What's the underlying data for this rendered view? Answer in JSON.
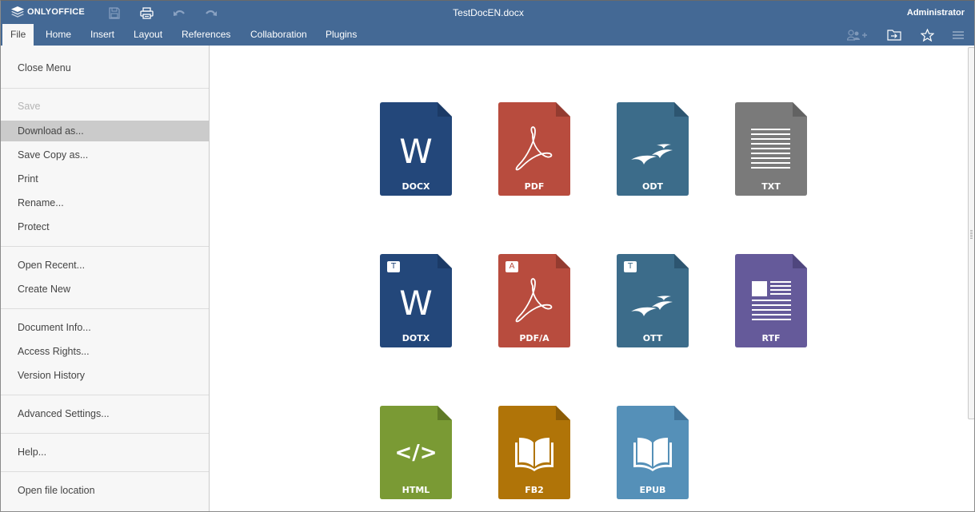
{
  "app": {
    "brand": "ONLYOFFICE",
    "document_title": "TestDocEN.docx",
    "user": "Administrator"
  },
  "quick_access": [
    {
      "name": "save-icon",
      "enabled": false
    },
    {
      "name": "print-icon",
      "enabled": true
    },
    {
      "name": "undo-icon",
      "enabled": false
    },
    {
      "name": "redo-icon",
      "enabled": false
    }
  ],
  "tabs": [
    {
      "label": "File",
      "active": true
    },
    {
      "label": "Home"
    },
    {
      "label": "Insert"
    },
    {
      "label": "Layout"
    },
    {
      "label": "References"
    },
    {
      "label": "Collaboration"
    },
    {
      "label": "Plugins"
    }
  ],
  "right_toolbar": [
    {
      "name": "add-user-icon",
      "enabled": false
    },
    {
      "name": "open-location-icon",
      "enabled": true
    },
    {
      "name": "favorite-star-icon",
      "enabled": true
    },
    {
      "name": "hamburger-menu-icon",
      "enabled": true
    }
  ],
  "file_menu": {
    "items": [
      {
        "label": "Close Menu"
      },
      {
        "label": "Save",
        "disabled": true
      },
      {
        "label": "Download as...",
        "selected": true
      },
      {
        "label": "Save Copy as..."
      },
      {
        "label": "Print"
      },
      {
        "label": "Rename..."
      },
      {
        "label": "Protect"
      },
      {
        "label": "Open Recent..."
      },
      {
        "label": "Create New"
      },
      {
        "label": "Document Info..."
      },
      {
        "label": "Access Rights..."
      },
      {
        "label": "Version History"
      },
      {
        "label": "Advanced Settings..."
      },
      {
        "label": "Help..."
      },
      {
        "label": "Open file location"
      }
    ]
  },
  "download_formats": [
    {
      "label": "DOCX",
      "color": "#23477a",
      "fold": "#1b3a66",
      "glyph": "word"
    },
    {
      "label": "PDF",
      "color": "#b84c3e",
      "fold": "#933b30",
      "glyph": "pdf"
    },
    {
      "label": "ODT",
      "color": "#3c6c8a",
      "fold": "#2d5570",
      "glyph": "birds"
    },
    {
      "label": "TXT",
      "color": "#7a7a7a",
      "fold": "#626262",
      "glyph": "lines"
    },
    {
      "label": "DOTX",
      "color": "#23477a",
      "fold": "#1b3a66",
      "glyph": "word",
      "badge": "T"
    },
    {
      "label": "PDF/A",
      "color": "#b84c3e",
      "fold": "#933b30",
      "glyph": "pdf",
      "badge": "A"
    },
    {
      "label": "OTT",
      "color": "#3c6c8a",
      "fold": "#2d5570",
      "glyph": "birds",
      "badge": "T"
    },
    {
      "label": "RTF",
      "color": "#655a9a",
      "fold": "#4f467e",
      "glyph": "rtf"
    },
    {
      "label": "HTML",
      "color": "#7a9a34",
      "fold": "#5f7a26",
      "glyph": "code"
    },
    {
      "label": "FB2",
      "color": "#b07408",
      "fold": "#8c5c06",
      "glyph": "book"
    },
    {
      "label": "EPUB",
      "color": "#5590b8",
      "fold": "#41749a",
      "glyph": "book"
    }
  ],
  "colors": {
    "header": "#446995",
    "menu_bg": "#f7f7f7",
    "menu_selected": "#cbcbcb"
  }
}
